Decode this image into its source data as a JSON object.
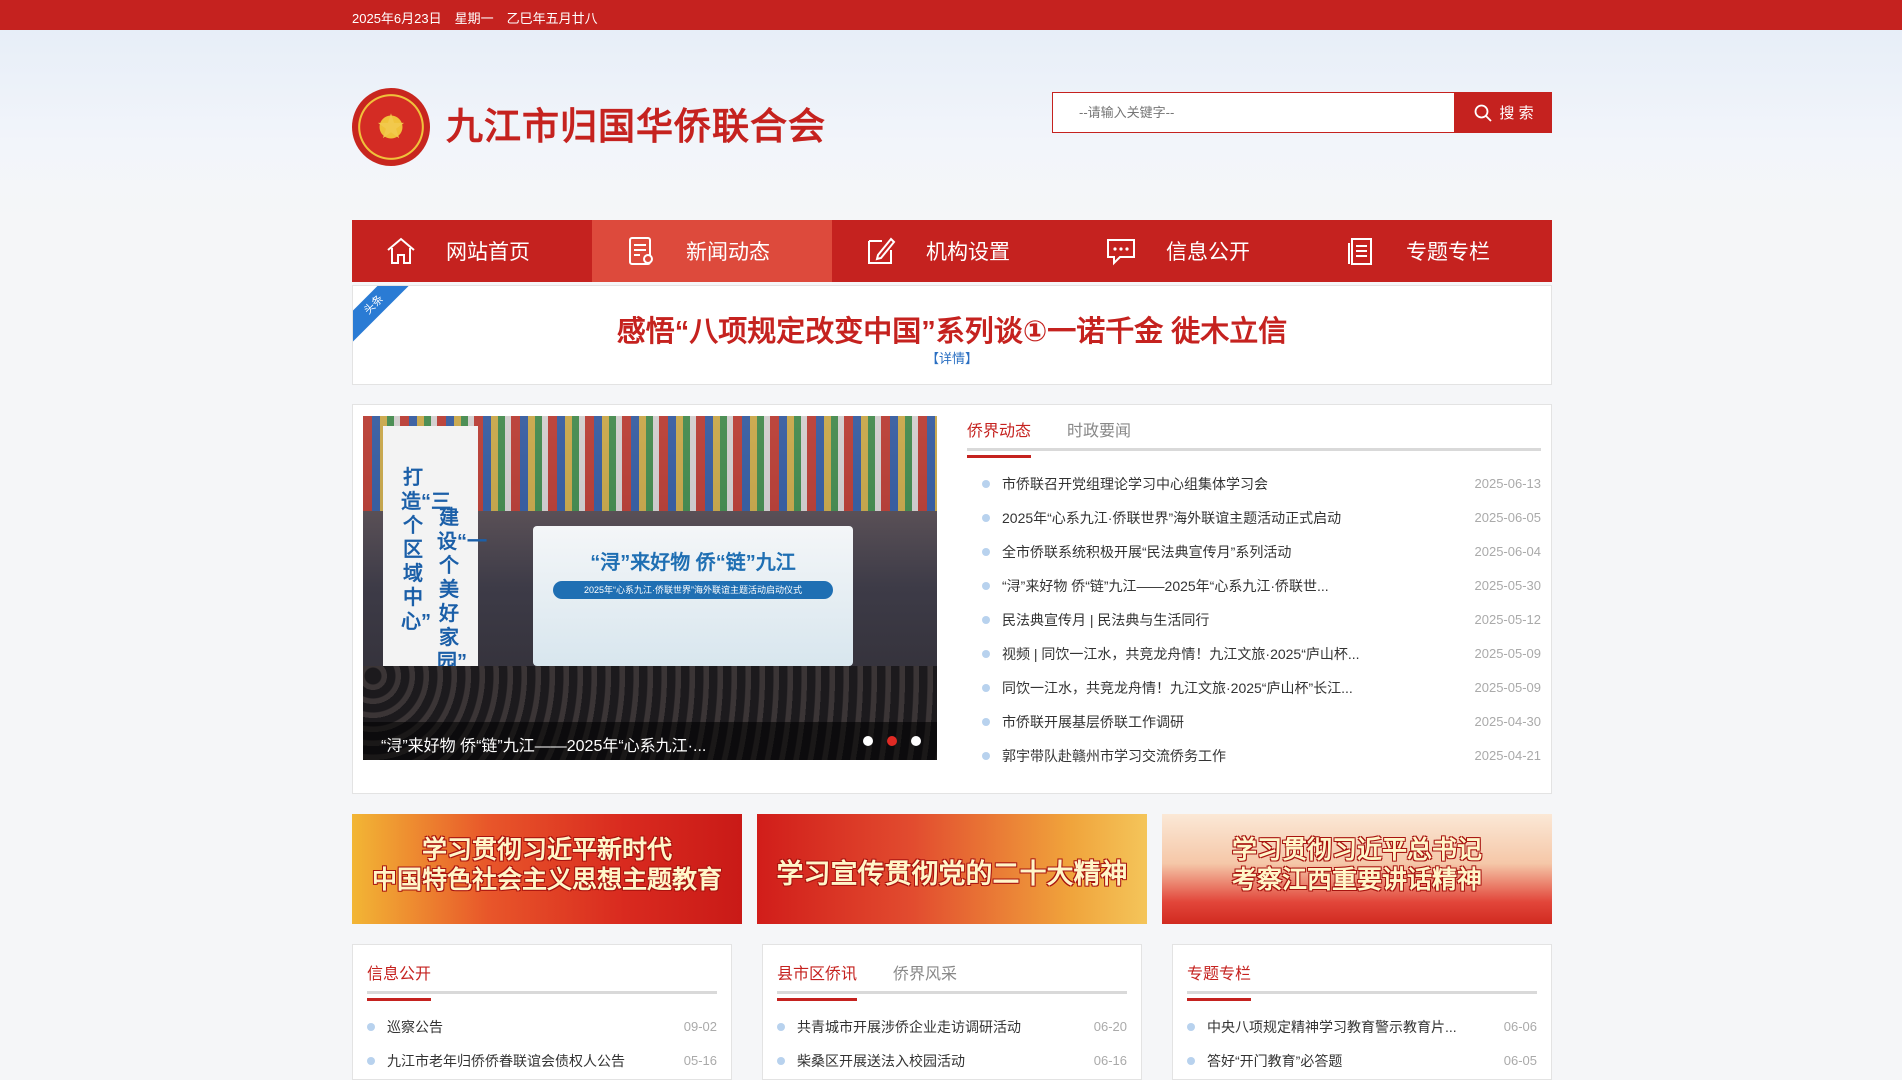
{
  "topbar": {
    "date": "2025年6月23日　星期一　乙巳年五月廿八"
  },
  "header": {
    "site_title": "九江市归国华侨联合会",
    "logo_icon": "federation-star-emblem-icon",
    "search_placeholder": "--请输入关键字--",
    "search_button": "搜 索"
  },
  "nav": {
    "items": [
      {
        "label": "网站首页",
        "icon": "home-icon"
      },
      {
        "label": "新闻动态",
        "icon": "news-icon"
      },
      {
        "label": "机构设置",
        "icon": "edit-icon"
      },
      {
        "label": "信息公开",
        "icon": "message-icon"
      },
      {
        "label": "专题专栏",
        "icon": "document-icon"
      }
    ],
    "active_index": 1
  },
  "headline": {
    "ribbon": "头条",
    "title": "感悟“八项规定改变中国”系列谈①一诺千金 徙木立信",
    "detail": "【详情】"
  },
  "slideshow": {
    "caption": "“浔”来好物 侨“链”九江——2025年“心系九江·...",
    "stage_title": "“浔”来好物 侨“链”九江",
    "stage_subtitle": "2025年“心系九江·侨联世界”海外联谊主题活动启动仪式",
    "banner_left": "打造“三个区域中心”",
    "banner_right": "建设“一个美好家园”",
    "dot_count": 3,
    "active_dot": 1
  },
  "news": {
    "tabs": [
      "侨界动态",
      "时政要闻"
    ],
    "active_tab": 0,
    "items": [
      {
        "title": "市侨联召开党组理论学习中心组集体学习会",
        "date": "2025-06-13"
      },
      {
        "title": "2025年“心系九江·侨联世界”海外联谊主题活动正式启动",
        "date": "2025-06-05"
      },
      {
        "title": "全市侨联系统积极开展“民法典宣传月”系列活动",
        "date": "2025-06-04"
      },
      {
        "title": "“浔”来好物 侨“链”九江——2025年“心系九江·侨联世...",
        "date": "2025-05-30"
      },
      {
        "title": "民法典宣传月 | 民法典与生活同行",
        "date": "2025-05-12"
      },
      {
        "title": "视频 | 同饮一江水，共竞龙舟情！九江文旅·2025“庐山杯...",
        "date": "2025-05-09"
      },
      {
        "title": "同饮一江水，共竞龙舟情！九江文旅·2025“庐山杯”长江...",
        "date": "2025-05-09"
      },
      {
        "title": "市侨联开展基层侨联工作调研",
        "date": "2025-04-30"
      },
      {
        "title": "郭宇带队赴赣州市学习交流侨务工作",
        "date": "2025-04-21"
      }
    ]
  },
  "banners": [
    {
      "line1": "学习贯彻习近平新时代",
      "line2": "中国特色社会主义思想主题教育"
    },
    {
      "line1": "学习宣传贯彻党的二十大精神",
      "line2": ""
    },
    {
      "line1": "学习贯彻习近平总书记",
      "line2": "考察江西重要讲话精神"
    }
  ],
  "cards": [
    {
      "tabs": [
        "信息公开"
      ],
      "items": [
        {
          "title": "巡察公告",
          "date": "09-02"
        },
        {
          "title": "九江市老年归侨侨眷联谊会债权人公告",
          "date": "05-16"
        }
      ]
    },
    {
      "tabs": [
        "县市区侨讯",
        "侨界风采"
      ],
      "items": [
        {
          "title": "共青城市开展涉侨企业走访调研活动",
          "date": "06-20"
        },
        {
          "title": "柴桑区开展送法入校园活动",
          "date": "06-16"
        }
      ]
    },
    {
      "tabs": [
        "专题专栏"
      ],
      "items": [
        {
          "title": "中央八项规定精神学习教育警示教育片...",
          "date": "06-06"
        },
        {
          "title": "答好“开门教育”必答题",
          "date": "06-05"
        }
      ]
    }
  ],
  "colors": {
    "brand_red": "#c5221f",
    "nav_active": "#dd4a3c",
    "link_blue": "#2a6fc2"
  }
}
